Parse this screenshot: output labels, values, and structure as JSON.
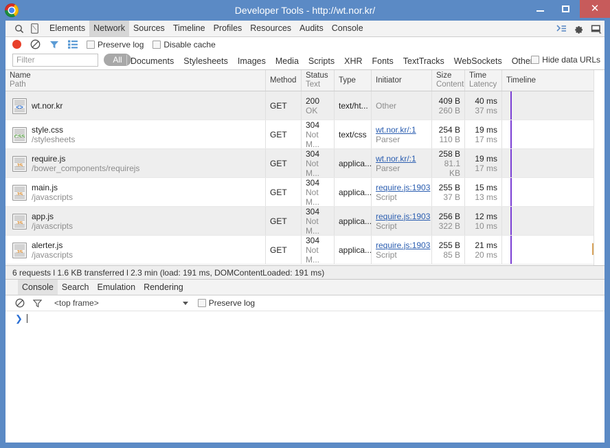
{
  "window": {
    "title": "Developer Tools - http://wt.nor.kr/",
    "logo_icon": "chrome-logo",
    "minimize_label": "–",
    "maximize_label": "☐",
    "close_label": "✕"
  },
  "tabbar": {
    "search_icon": "search-icon",
    "device_icon": "device-toggle-icon",
    "tabs": [
      {
        "label": "Elements",
        "active": false
      },
      {
        "label": "Network",
        "active": true
      },
      {
        "label": "Sources",
        "active": false
      },
      {
        "label": "Timeline",
        "active": false
      },
      {
        "label": "Profiles",
        "active": false
      },
      {
        "label": "Resources",
        "active": false
      },
      {
        "label": "Audits",
        "active": false
      },
      {
        "label": "Console",
        "active": false
      }
    ],
    "right_icons": [
      "console-drawer-icon",
      "settings-gear-icon",
      "dock-position-icon"
    ]
  },
  "network_toolbar": {
    "record_icon": "record-button",
    "clear_icon": "clear-icon",
    "filter_icon": "filter-funnel-icon",
    "large_rows_icon": "large-rows-icon",
    "preserve_log_label": "Preserve log",
    "preserve_log_checked": false,
    "disable_cache_label": "Disable cache",
    "disable_cache_checked": false
  },
  "filter_bar": {
    "filter_placeholder": "Filter",
    "filter_value": "",
    "all_label": "All",
    "types": [
      "Documents",
      "Stylesheets",
      "Images",
      "Media",
      "Scripts",
      "XHR",
      "Fonts",
      "TextTracks",
      "WebSockets",
      "Other"
    ],
    "hide_data_urls_label": "Hide data URLs",
    "hide_data_urls_checked": false
  },
  "table": {
    "columns": [
      {
        "top": "Name",
        "bottom": "Path"
      },
      {
        "top": "Method",
        "bottom": ""
      },
      {
        "top": "Status",
        "bottom": "Text"
      },
      {
        "top": "Type",
        "bottom": ""
      },
      {
        "top": "Initiator",
        "bottom": ""
      },
      {
        "top": "Size",
        "bottom": "Content"
      },
      {
        "top": "Time",
        "bottom": "Latency"
      },
      {
        "top": "Timeline",
        "bottom": ""
      }
    ],
    "rows": [
      {
        "icon": "document-html-icon",
        "icon_label": "<>",
        "icon_kind": "doc",
        "name": "wt.nor.kr",
        "path": "",
        "method": "GET",
        "status": "200",
        "status_text": "OK",
        "type": "text/ht...",
        "initiator": "Other",
        "initiator_sub": "",
        "initiator_link": false,
        "size": "409 B",
        "content": "260 B",
        "time": "40 ms",
        "latency": "37 ms"
      },
      {
        "icon": "document-css-icon",
        "icon_label": "CSS",
        "icon_kind": "css",
        "name": "style.css",
        "path": "/stylesheets",
        "method": "GET",
        "status": "304",
        "status_text": "Not M...",
        "type": "text/css",
        "initiator": "wt.nor.kr/:1",
        "initiator_sub": "Parser",
        "initiator_link": true,
        "size": "254 B",
        "content": "110 B",
        "time": "19 ms",
        "latency": "17 ms"
      },
      {
        "icon": "document-js-icon",
        "icon_label": "JS",
        "icon_kind": "js",
        "name": "require.js",
        "path": "/bower_components/requirejs",
        "method": "GET",
        "status": "304",
        "status_text": "Not M...",
        "type": "applica...",
        "initiator": "wt.nor.kr/:1",
        "initiator_sub": "Parser",
        "initiator_link": true,
        "size": "258 B",
        "content": "81.1 KB",
        "time": "19 ms",
        "latency": "17 ms"
      },
      {
        "icon": "document-js-icon",
        "icon_label": "JS",
        "icon_kind": "js",
        "name": "main.js",
        "path": "/javascripts",
        "method": "GET",
        "status": "304",
        "status_text": "Not M...",
        "type": "applica...",
        "initiator": "require.js:1903",
        "initiator_sub": "Script",
        "initiator_link": true,
        "size": "255 B",
        "content": "37 B",
        "time": "15 ms",
        "latency": "13 ms"
      },
      {
        "icon": "document-js-icon",
        "icon_label": "JS",
        "icon_kind": "js",
        "name": "app.js",
        "path": "/javascripts",
        "method": "GET",
        "status": "304",
        "status_text": "Not M...",
        "type": "applica...",
        "initiator": "require.js:1903",
        "initiator_sub": "Script",
        "initiator_link": true,
        "size": "256 B",
        "content": "322 B",
        "time": "12 ms",
        "latency": "10 ms"
      },
      {
        "icon": "document-js-icon",
        "icon_label": "JS",
        "icon_kind": "js",
        "name": "alerter.js",
        "path": "/javascripts",
        "method": "GET",
        "status": "304",
        "status_text": "Not M...",
        "type": "applica...",
        "initiator": "require.js:1903",
        "initiator_sub": "Script",
        "initiator_link": true,
        "size": "255 B",
        "content": "85 B",
        "time": "21 ms",
        "latency": "20 ms"
      }
    ]
  },
  "summary": {
    "text": "6 requests l 1.6 KB transferred l 2.3 min (load: 191 ms, DOMContentLoaded: 191 ms)"
  },
  "drawer": {
    "tabs": [
      {
        "label": "Console",
        "active": true
      },
      {
        "label": "Search",
        "active": false
      },
      {
        "label": "Emulation",
        "active": false
      },
      {
        "label": "Rendering",
        "active": false
      }
    ],
    "clear_icon": "clear-console-icon",
    "filter_icon": "filter-funnel-icon",
    "frame_selector": "<top frame>",
    "preserve_log_label": "Preserve log",
    "preserve_log_checked": false,
    "prompt_symbol": "❯",
    "prompt_value": ""
  },
  "colors": {
    "titlebar": "#5b8ac5",
    "close_button": "#c75b5b",
    "record": "#e8402a",
    "filter_blue": "#5b9bd5",
    "timeline_marker": "#7b3fd4",
    "timeline_bar": "#d8a25a",
    "link": "#2a5db0",
    "active_tab": "#d6d6d6"
  }
}
